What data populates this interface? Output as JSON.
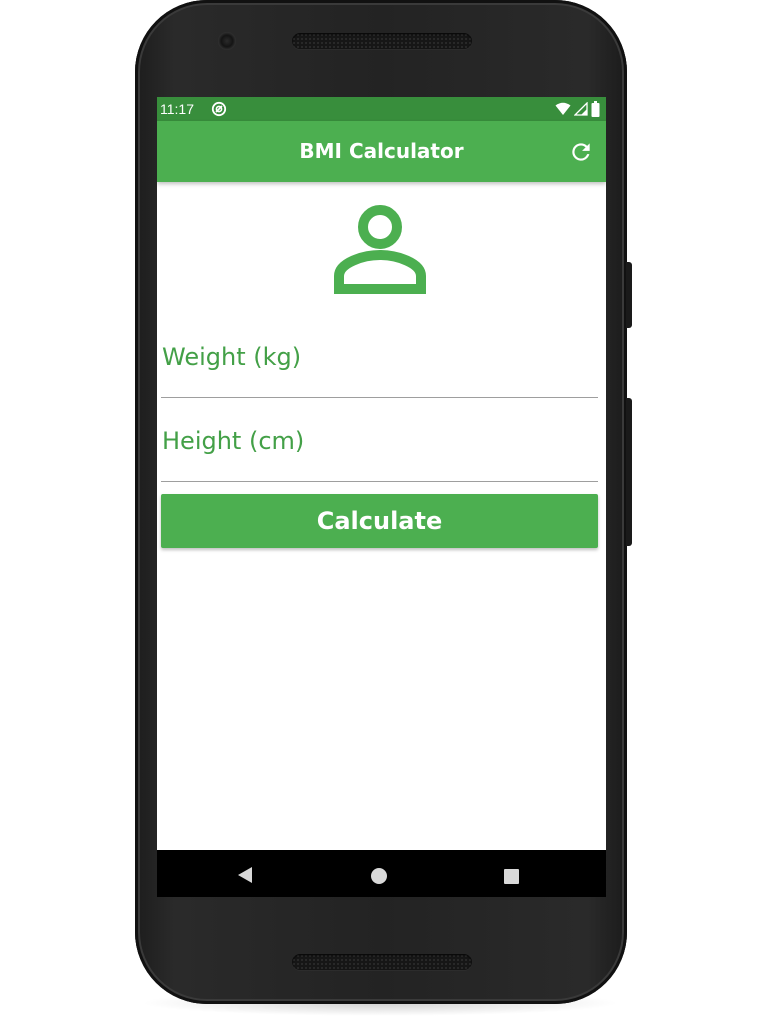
{
  "status_bar": {
    "time": "11:17",
    "icons": [
      "app-notification-icon",
      "wifi-icon",
      "signal-icon",
      "battery-icon"
    ]
  },
  "app_bar": {
    "title": "BMI Calculator",
    "action_icon": "refresh-icon"
  },
  "avatar_icon": "person-icon",
  "form": {
    "weight": {
      "placeholder": "Weight (kg)",
      "value": ""
    },
    "height": {
      "placeholder": "Height (cm)",
      "value": ""
    },
    "calculate_label": "Calculate"
  },
  "nav_bar": {
    "icons": [
      "back-icon",
      "home-icon",
      "recents-icon"
    ]
  },
  "colors": {
    "primary": "#4caf50",
    "primary_dark": "#388e3c",
    "hint_text": "#43a047"
  }
}
